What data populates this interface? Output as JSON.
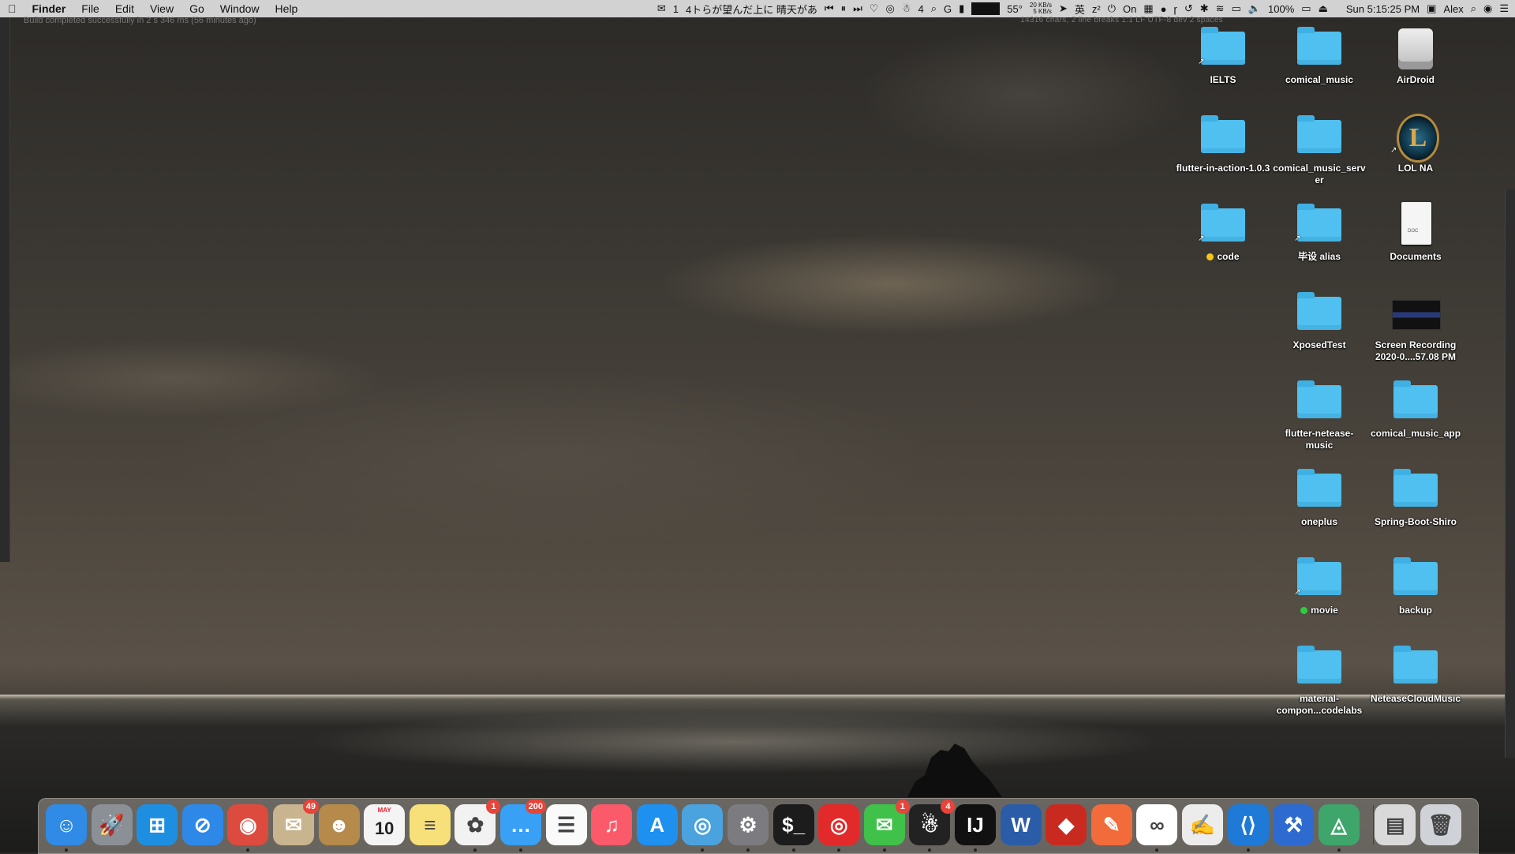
{
  "menubar": {
    "app_name": "Finder",
    "menus": [
      "File",
      "Edit",
      "View",
      "Go",
      "Window",
      "Help"
    ],
    "now_playing_count": "1",
    "now_playing_title": "4トらが望んだ上に 晴天があ",
    "notification_count": "4",
    "temperature": "55°",
    "net_up": "20 KB/s",
    "net_down": "5 KB/s",
    "focus_status": "On",
    "battery": "100%",
    "clock": "Sun 5:15:25 PM",
    "user": "Alex"
  },
  "editor": {
    "build_status": "Build completed successfully in 2 s 346 ms (56 minutes ago)",
    "status_right": "14316 chars, 2 line breaks   1:1   LF   UTF-8   dev   2 spaces"
  },
  "desktop": {
    "icons": [
      {
        "label": "IELTS",
        "kind": "folder",
        "alias": true
      },
      {
        "label": "comical_music",
        "kind": "folder"
      },
      {
        "label": "AirDroid",
        "kind": "drive"
      },
      {
        "label": "flutter-in-action-1.0.3",
        "kind": "folder"
      },
      {
        "label": "comical_music_server",
        "kind": "folder"
      },
      {
        "label": "LOL NA",
        "kind": "lol",
        "alias": true
      },
      {
        "label": "code",
        "kind": "folder",
        "alias": true,
        "tag": "#f5c518"
      },
      {
        "label": "毕设 alias",
        "kind": "folder",
        "alias": true
      },
      {
        "label": "Documents",
        "kind": "doc"
      },
      {
        "label": "XposedTest",
        "kind": "folder"
      },
      {
        "label": "Screen Recording 2020-0....57.08 PM",
        "kind": "thumb"
      },
      {
        "label": "flutter-netease-music",
        "kind": "folder"
      },
      {
        "label": "comical_music_app",
        "kind": "folder"
      },
      {
        "label": "oneplus",
        "kind": "folder"
      },
      {
        "label": "Spring-Boot-Shiro",
        "kind": "folder"
      },
      {
        "label": "movie",
        "kind": "folder",
        "alias": true,
        "tag": "#2ecc40"
      },
      {
        "label": "backup",
        "kind": "folder"
      },
      {
        "label": "material-compon...codelabs",
        "kind": "folder"
      },
      {
        "label": "NeteaseCloudMusic",
        "kind": "folder"
      }
    ]
  },
  "dock": {
    "apps": [
      {
        "name": "finder",
        "glyph": "☺",
        "color": "#2f8be6",
        "running": true
      },
      {
        "name": "launchpad",
        "glyph": "🚀",
        "color": "#8b8f96"
      },
      {
        "name": "windows",
        "glyph": "⊞",
        "color": "#1e8fe0"
      },
      {
        "name": "safari",
        "glyph": "⊘",
        "color": "#2e88e8"
      },
      {
        "name": "chrome",
        "glyph": "◉",
        "color": "#dd4b3e",
        "running": true
      },
      {
        "name": "mail",
        "glyph": "✉",
        "color": "#c8b48e",
        "badge": "49"
      },
      {
        "name": "contacts",
        "glyph": "☻",
        "color": "#b58a4a"
      },
      {
        "name": "calendar",
        "glyph": "10",
        "color": "#f4f4f4",
        "label_top": "MAY"
      },
      {
        "name": "notes",
        "glyph": "≡",
        "color": "#f7e07a"
      },
      {
        "name": "photos",
        "glyph": "✿",
        "color": "#f2f2f2",
        "badge": "1",
        "running": true
      },
      {
        "name": "messages",
        "glyph": "…",
        "color": "#38a0f5",
        "badge": "200",
        "running": true
      },
      {
        "name": "reminders",
        "glyph": "☰",
        "color": "#fafafa"
      },
      {
        "name": "music",
        "glyph": "♫",
        "color": "#fa5a6a"
      },
      {
        "name": "app-store",
        "glyph": "A",
        "color": "#1e90f0"
      },
      {
        "name": "network-utility",
        "glyph": "◎",
        "color": "#4aa3df",
        "running": true
      },
      {
        "name": "system-preferences",
        "glyph": "⚙",
        "color": "#7c7c80",
        "running": true
      },
      {
        "name": "terminal",
        "glyph": "$_",
        "color": "#1c1c1c",
        "running": true
      },
      {
        "name": "netease-music",
        "glyph": "◎",
        "color": "#e22a2a",
        "running": true
      },
      {
        "name": "wechat",
        "glyph": "✉",
        "color": "#3fc14a",
        "badge": "1",
        "running": true
      },
      {
        "name": "qq",
        "glyph": "☃",
        "color": "#222222",
        "badge": "4",
        "running": true
      },
      {
        "name": "intellij",
        "glyph": "IJ",
        "color": "#111111",
        "running": true
      },
      {
        "name": "word",
        "glyph": "W",
        "color": "#2b5ca8"
      },
      {
        "name": "redis",
        "glyph": "◆",
        "color": "#c92a20"
      },
      {
        "name": "postman",
        "glyph": "✎",
        "color": "#f26b3a"
      },
      {
        "name": "baidu-netdisk",
        "glyph": "∞",
        "color": "#ffffff",
        "running": true
      },
      {
        "name": "textedit",
        "glyph": "✍",
        "color": "#ececec"
      },
      {
        "name": "vscode",
        "glyph": "⟨⟩",
        "color": "#1e7ad6",
        "running": true
      },
      {
        "name": "xcode",
        "glyph": "⚒",
        "color": "#2d6bd1"
      },
      {
        "name": "android-studio",
        "glyph": "◬",
        "color": "#3fa66b",
        "running": true
      },
      {
        "name": "downloads-stack",
        "glyph": "▤",
        "color": "#d9d9d9"
      },
      {
        "name": "trash",
        "glyph": "🗑",
        "color": "#cfd2d6"
      }
    ]
  }
}
